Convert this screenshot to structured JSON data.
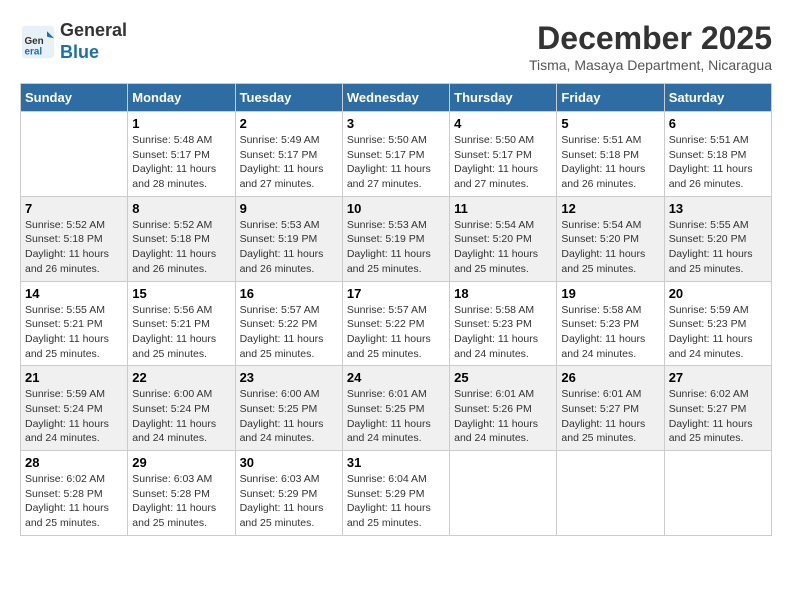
{
  "header": {
    "logo_general": "General",
    "logo_blue": "Blue",
    "month_title": "December 2025",
    "subtitle": "Tisma, Masaya Department, Nicaragua"
  },
  "weekdays": [
    "Sunday",
    "Monday",
    "Tuesday",
    "Wednesday",
    "Thursday",
    "Friday",
    "Saturday"
  ],
  "weeks": [
    [
      {
        "day": "",
        "sunrise": "",
        "sunset": "",
        "daylight": ""
      },
      {
        "day": "1",
        "sunrise": "Sunrise: 5:48 AM",
        "sunset": "Sunset: 5:17 PM",
        "daylight": "Daylight: 11 hours and 28 minutes."
      },
      {
        "day": "2",
        "sunrise": "Sunrise: 5:49 AM",
        "sunset": "Sunset: 5:17 PM",
        "daylight": "Daylight: 11 hours and 27 minutes."
      },
      {
        "day": "3",
        "sunrise": "Sunrise: 5:50 AM",
        "sunset": "Sunset: 5:17 PM",
        "daylight": "Daylight: 11 hours and 27 minutes."
      },
      {
        "day": "4",
        "sunrise": "Sunrise: 5:50 AM",
        "sunset": "Sunset: 5:17 PM",
        "daylight": "Daylight: 11 hours and 27 minutes."
      },
      {
        "day": "5",
        "sunrise": "Sunrise: 5:51 AM",
        "sunset": "Sunset: 5:18 PM",
        "daylight": "Daylight: 11 hours and 26 minutes."
      },
      {
        "day": "6",
        "sunrise": "Sunrise: 5:51 AM",
        "sunset": "Sunset: 5:18 PM",
        "daylight": "Daylight: 11 hours and 26 minutes."
      }
    ],
    [
      {
        "day": "7",
        "sunrise": "Sunrise: 5:52 AM",
        "sunset": "Sunset: 5:18 PM",
        "daylight": "Daylight: 11 hours and 26 minutes."
      },
      {
        "day": "8",
        "sunrise": "Sunrise: 5:52 AM",
        "sunset": "Sunset: 5:18 PM",
        "daylight": "Daylight: 11 hours and 26 minutes."
      },
      {
        "day": "9",
        "sunrise": "Sunrise: 5:53 AM",
        "sunset": "Sunset: 5:19 PM",
        "daylight": "Daylight: 11 hours and 26 minutes."
      },
      {
        "day": "10",
        "sunrise": "Sunrise: 5:53 AM",
        "sunset": "Sunset: 5:19 PM",
        "daylight": "Daylight: 11 hours and 25 minutes."
      },
      {
        "day": "11",
        "sunrise": "Sunrise: 5:54 AM",
        "sunset": "Sunset: 5:20 PM",
        "daylight": "Daylight: 11 hours and 25 minutes."
      },
      {
        "day": "12",
        "sunrise": "Sunrise: 5:54 AM",
        "sunset": "Sunset: 5:20 PM",
        "daylight": "Daylight: 11 hours and 25 minutes."
      },
      {
        "day": "13",
        "sunrise": "Sunrise: 5:55 AM",
        "sunset": "Sunset: 5:20 PM",
        "daylight": "Daylight: 11 hours and 25 minutes."
      }
    ],
    [
      {
        "day": "14",
        "sunrise": "Sunrise: 5:55 AM",
        "sunset": "Sunset: 5:21 PM",
        "daylight": "Daylight: 11 hours and 25 minutes."
      },
      {
        "day": "15",
        "sunrise": "Sunrise: 5:56 AM",
        "sunset": "Sunset: 5:21 PM",
        "daylight": "Daylight: 11 hours and 25 minutes."
      },
      {
        "day": "16",
        "sunrise": "Sunrise: 5:57 AM",
        "sunset": "Sunset: 5:22 PM",
        "daylight": "Daylight: 11 hours and 25 minutes."
      },
      {
        "day": "17",
        "sunrise": "Sunrise: 5:57 AM",
        "sunset": "Sunset: 5:22 PM",
        "daylight": "Daylight: 11 hours and 25 minutes."
      },
      {
        "day": "18",
        "sunrise": "Sunrise: 5:58 AM",
        "sunset": "Sunset: 5:23 PM",
        "daylight": "Daylight: 11 hours and 24 minutes."
      },
      {
        "day": "19",
        "sunrise": "Sunrise: 5:58 AM",
        "sunset": "Sunset: 5:23 PM",
        "daylight": "Daylight: 11 hours and 24 minutes."
      },
      {
        "day": "20",
        "sunrise": "Sunrise: 5:59 AM",
        "sunset": "Sunset: 5:23 PM",
        "daylight": "Daylight: 11 hours and 24 minutes."
      }
    ],
    [
      {
        "day": "21",
        "sunrise": "Sunrise: 5:59 AM",
        "sunset": "Sunset: 5:24 PM",
        "daylight": "Daylight: 11 hours and 24 minutes."
      },
      {
        "day": "22",
        "sunrise": "Sunrise: 6:00 AM",
        "sunset": "Sunset: 5:24 PM",
        "daylight": "Daylight: 11 hours and 24 minutes."
      },
      {
        "day": "23",
        "sunrise": "Sunrise: 6:00 AM",
        "sunset": "Sunset: 5:25 PM",
        "daylight": "Daylight: 11 hours and 24 minutes."
      },
      {
        "day": "24",
        "sunrise": "Sunrise: 6:01 AM",
        "sunset": "Sunset: 5:25 PM",
        "daylight": "Daylight: 11 hours and 24 minutes."
      },
      {
        "day": "25",
        "sunrise": "Sunrise: 6:01 AM",
        "sunset": "Sunset: 5:26 PM",
        "daylight": "Daylight: 11 hours and 24 minutes."
      },
      {
        "day": "26",
        "sunrise": "Sunrise: 6:01 AM",
        "sunset": "Sunset: 5:27 PM",
        "daylight": "Daylight: 11 hours and 25 minutes."
      },
      {
        "day": "27",
        "sunrise": "Sunrise: 6:02 AM",
        "sunset": "Sunset: 5:27 PM",
        "daylight": "Daylight: 11 hours and 25 minutes."
      }
    ],
    [
      {
        "day": "28",
        "sunrise": "Sunrise: 6:02 AM",
        "sunset": "Sunset: 5:28 PM",
        "daylight": "Daylight: 11 hours and 25 minutes."
      },
      {
        "day": "29",
        "sunrise": "Sunrise: 6:03 AM",
        "sunset": "Sunset: 5:28 PM",
        "daylight": "Daylight: 11 hours and 25 minutes."
      },
      {
        "day": "30",
        "sunrise": "Sunrise: 6:03 AM",
        "sunset": "Sunset: 5:29 PM",
        "daylight": "Daylight: 11 hours and 25 minutes."
      },
      {
        "day": "31",
        "sunrise": "Sunrise: 6:04 AM",
        "sunset": "Sunset: 5:29 PM",
        "daylight": "Daylight: 11 hours and 25 minutes."
      },
      {
        "day": "",
        "sunrise": "",
        "sunset": "",
        "daylight": ""
      },
      {
        "day": "",
        "sunrise": "",
        "sunset": "",
        "daylight": ""
      },
      {
        "day": "",
        "sunrise": "",
        "sunset": "",
        "daylight": ""
      }
    ]
  ]
}
